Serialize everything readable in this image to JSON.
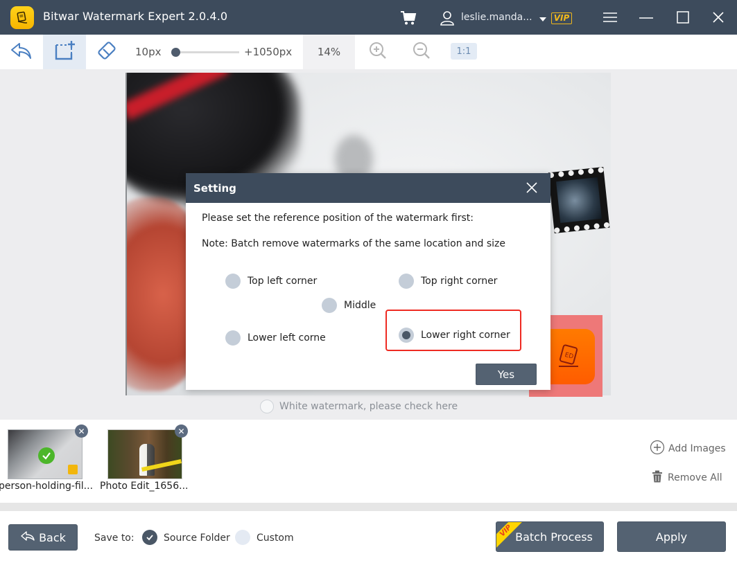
{
  "app": {
    "title": "Bitwar Watermark Expert  2.0.4.0",
    "username": "leslie.manda...",
    "vip_badge": "VIP",
    "icons": {
      "logo": "app-logo-eraser-icon",
      "cart": "cart-icon",
      "user": "user-icon",
      "menu": "hamburger-menu-icon",
      "minimize": "minimize-icon",
      "maximize": "maximize-icon",
      "close": "close-icon"
    }
  },
  "toolbar": {
    "brush_size_min": "10px",
    "brush_size_max": "+1050px",
    "brush_size_value": "10px",
    "zoom_level": "14%",
    "one_to_one": "1:1",
    "icons": [
      "undo-icon",
      "rectangle-select-icon",
      "eraser-icon",
      "zoom-in-icon",
      "zoom-out-icon"
    ]
  },
  "canvas": {
    "white_watermark_label": "White watermark, please check here",
    "white_watermark_checked": false,
    "watermark_highlight_color": "#ee7878"
  },
  "dialog": {
    "title": "Setting",
    "instruction": "Please set the reference position of the watermark first:",
    "note": "Note: Batch remove watermarks of the same location and size",
    "options": [
      {
        "label": "Top left corner",
        "selected": false
      },
      {
        "label": "Top right corner",
        "selected": false
      },
      {
        "label": "Middle",
        "selected": false
      },
      {
        "label": "Lower left corne",
        "selected": false
      },
      {
        "label": "Lower right corner",
        "selected": true
      }
    ],
    "confirm_label": "Yes",
    "highlight_color": "#ee2a22"
  },
  "thumbnails": [
    {
      "name": "person-holding-fil...",
      "processed": true
    },
    {
      "name": "Photo Edit_1656...",
      "processed": false
    }
  ],
  "file_actions": {
    "add_images": "Add Images",
    "remove_all": "Remove All"
  },
  "bottom": {
    "back_label": "Back",
    "save_to_label": "Save to:",
    "source_folder_label": "Source Folder",
    "custom_label": "Custom",
    "save_target": "Source Folder",
    "batch_label": "Batch Process",
    "batch_vip": "VIP",
    "apply_label": "Apply"
  },
  "colors": {
    "header_bg": "#3d4b5c",
    "button_bg": "#546272",
    "vip_gold": "#f1b91c",
    "success_green": "#4cb62a"
  }
}
